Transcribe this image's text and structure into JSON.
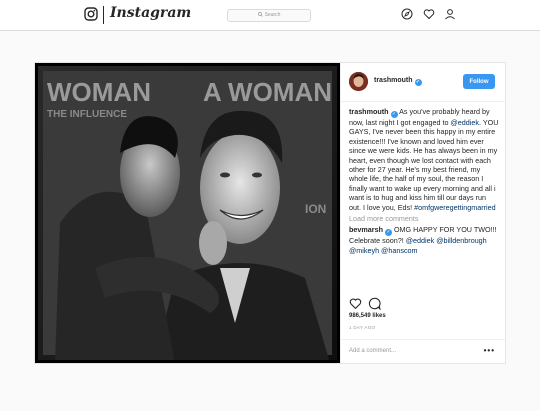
{
  "topbar": {
    "wordmark": "Instagram",
    "search_placeholder": "Search",
    "icons": [
      "instagram-glyph-icon",
      "compass-icon",
      "heart-icon",
      "person-icon"
    ]
  },
  "post": {
    "photo": {
      "backdrop_text_left": "WOMAN",
      "backdrop_text_left2": "THE INFLUENCE",
      "backdrop_text_right": "A WOMAN",
      "backdrop_text_right2": "ION"
    },
    "header": {
      "username": "trashmouth",
      "follow_label": "Follow"
    },
    "caption": {
      "username": "trashmouth",
      "text_before_mention": "As you've probably heard by now, last night I got engaged to ",
      "mention": "@eddiek",
      "text_after_mention": ". YOU GAYS, I've never been this happy in my entire existence!!! I've known and loved him ever since we were kids. He has always been in my heart, even though we lost contact with each other for 27 year. He's my best friend, my whole life, the half of my soul, the reason I finally want to wake up every morning and all i want is to hug and kiss him till our days run out. I love you, Eds! ",
      "hashtag": "#omfgweregettingmarried"
    },
    "load_more": "Load more comments",
    "comment": {
      "username": "bevmarsh",
      "text": "OMG HAPPY FOR YOU TWO!!! Celebrate soon?! ",
      "mentions": "@eddiek @billdenbrough @mikeyh @hanscom"
    },
    "likes": "986,549 likes",
    "time_ago": "1 DAY AGO",
    "add_comment_placeholder": "Add a comment...",
    "more_label": "•••"
  },
  "colors": {
    "accent": "#3897f0",
    "link": "#003569",
    "border": "#dbdbdb",
    "background": "#fafafa"
  }
}
